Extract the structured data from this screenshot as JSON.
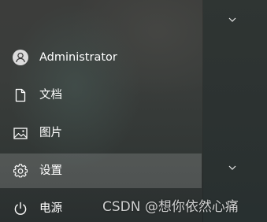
{
  "start_menu": {
    "items": [
      {
        "label": "Administrator",
        "icon": "user-avatar-icon"
      },
      {
        "label": "文档",
        "icon": "document-icon"
      },
      {
        "label": "图片",
        "icon": "picture-icon"
      },
      {
        "label": "设置",
        "icon": "gear-icon"
      },
      {
        "label": "电源",
        "icon": "power-icon"
      }
    ]
  },
  "right_panel": {
    "chevrons": [
      "chevron-down-icon",
      "chevron-down-icon"
    ]
  },
  "watermark": {
    "text": "CSDN @想你依然心痛"
  },
  "colors": {
    "text": "#ffffff",
    "highlight": "rgba(255,255,255,0.16)",
    "background": "#3a3d3b"
  }
}
